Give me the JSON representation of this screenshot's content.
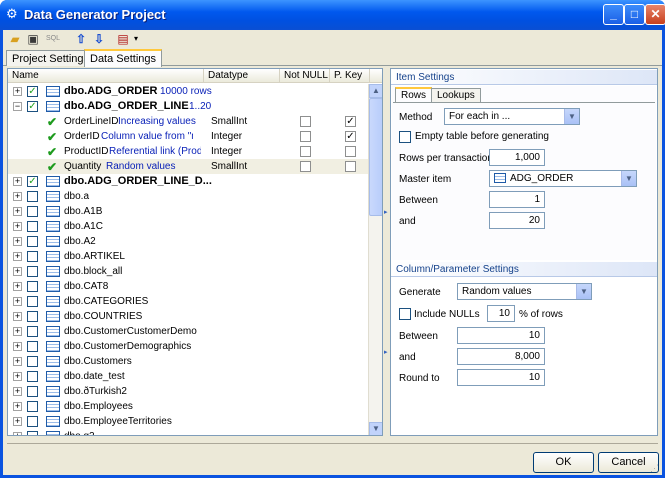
{
  "window": {
    "title": "Data Generator Project",
    "icon": "gear-icon"
  },
  "toolbar": {
    "items": [
      "open-folder-icon",
      "save-icon",
      "sql-icon",
      "arrow-up-icon",
      "arrow-down-icon",
      "tools-icon"
    ],
    "sql_label": "SQL"
  },
  "tabs": [
    {
      "label": "Project Settings",
      "active": false
    },
    {
      "label": "Data Settings",
      "active": true
    }
  ],
  "tree": {
    "headers": {
      "name": "Name",
      "datatype": "Datatype",
      "notnull": "Not NULL",
      "pkey": "P. Key"
    },
    "rows": [
      {
        "kind": "table",
        "expand": "+",
        "checked": true,
        "name": "dbo.ADG_ORDER",
        "bold": true,
        "info": "10000 rows"
      },
      {
        "kind": "table",
        "expand": "−",
        "checked": true,
        "name": "dbo.ADG_ORDER_LINE",
        "bold": true,
        "info": "1..20"
      },
      {
        "kind": "column",
        "name": "OrderLineID",
        "info": "Increasing values",
        "datatype": "SmallInt",
        "notnull": false,
        "pkey": true
      },
      {
        "kind": "column",
        "name": "OrderID",
        "info": "Column value from \"maste",
        "datatype": "Integer",
        "notnull": false,
        "pkey": true
      },
      {
        "kind": "column",
        "name": "ProductID",
        "info": "Referential link (Product",
        "datatype": "Integer",
        "notnull": false,
        "pkey": false
      },
      {
        "kind": "column",
        "name": "Quantity",
        "info": "Random values",
        "datatype": "SmallInt",
        "notnull": false,
        "pkey": false,
        "selected": true
      },
      {
        "kind": "table",
        "expand": "+",
        "checked": true,
        "name": "dbo.ADG_ORDER_LINE_D...",
        "bold": true,
        "info": ""
      },
      {
        "kind": "table",
        "expand": "+",
        "checked": false,
        "name": "dbo.a"
      },
      {
        "kind": "table",
        "expand": "+",
        "checked": false,
        "name": "dbo.A1B"
      },
      {
        "kind": "table",
        "expand": "+",
        "checked": false,
        "name": "dbo.A1C"
      },
      {
        "kind": "table",
        "expand": "+",
        "checked": false,
        "name": "dbo.A2"
      },
      {
        "kind": "table",
        "expand": "+",
        "checked": false,
        "name": "dbo.ARTIKEL"
      },
      {
        "kind": "table",
        "expand": "+",
        "checked": false,
        "name": "dbo.block_all"
      },
      {
        "kind": "table",
        "expand": "+",
        "checked": false,
        "name": "dbo.CAT8"
      },
      {
        "kind": "table",
        "expand": "+",
        "checked": false,
        "name": "dbo.CATEGORIES"
      },
      {
        "kind": "table",
        "expand": "+",
        "checked": false,
        "name": "dbo.COUNTRIES"
      },
      {
        "kind": "table",
        "expand": "+",
        "checked": false,
        "name": "dbo.CustomerCustomerDemo"
      },
      {
        "kind": "table",
        "expand": "+",
        "checked": false,
        "name": "dbo.CustomerDemographics"
      },
      {
        "kind": "table",
        "expand": "+",
        "checked": false,
        "name": "dbo.Customers"
      },
      {
        "kind": "table",
        "expand": "+",
        "checked": false,
        "name": "dbo.date_test"
      },
      {
        "kind": "table",
        "expand": "+",
        "checked": false,
        "name": "dbo.ðTurkish2"
      },
      {
        "kind": "table",
        "expand": "+",
        "checked": false,
        "name": "dbo.Employees"
      },
      {
        "kind": "table",
        "expand": "+",
        "checked": false,
        "name": "dbo.EmployeeTerritories"
      },
      {
        "kind": "table",
        "expand": "+",
        "checked": false,
        "name": "dbo.g2"
      }
    ]
  },
  "item_settings": {
    "title": "Item Settings",
    "tabs": [
      {
        "label": "Rows",
        "active": true
      },
      {
        "label": "Lookups",
        "active": false
      }
    ],
    "method_label": "Method",
    "method_value": "For each in ...",
    "empty_table_label": "Empty table before generating",
    "rows_per_tx_label": "Rows per transaction",
    "rows_per_tx_value": "1,000",
    "master_item_label": "Master item",
    "master_item_value": "ADG_ORDER",
    "between_label": "Between",
    "between_value": "1",
    "and_label": "and",
    "and_value": "20"
  },
  "column_settings": {
    "title": "Column/Parameter Settings",
    "generate_label": "Generate",
    "generate_value": "Random values",
    "include_nulls_label": "Include NULLs",
    "include_nulls_value": "10",
    "pct_rows_label": "% of rows",
    "between_label": "Between",
    "between_value": "10",
    "and_label": "and",
    "and_value": "8,000",
    "round_label": "Round to",
    "round_value": "10"
  },
  "footer": {
    "ok_label": "OK",
    "cancel_label": "Cancel"
  }
}
